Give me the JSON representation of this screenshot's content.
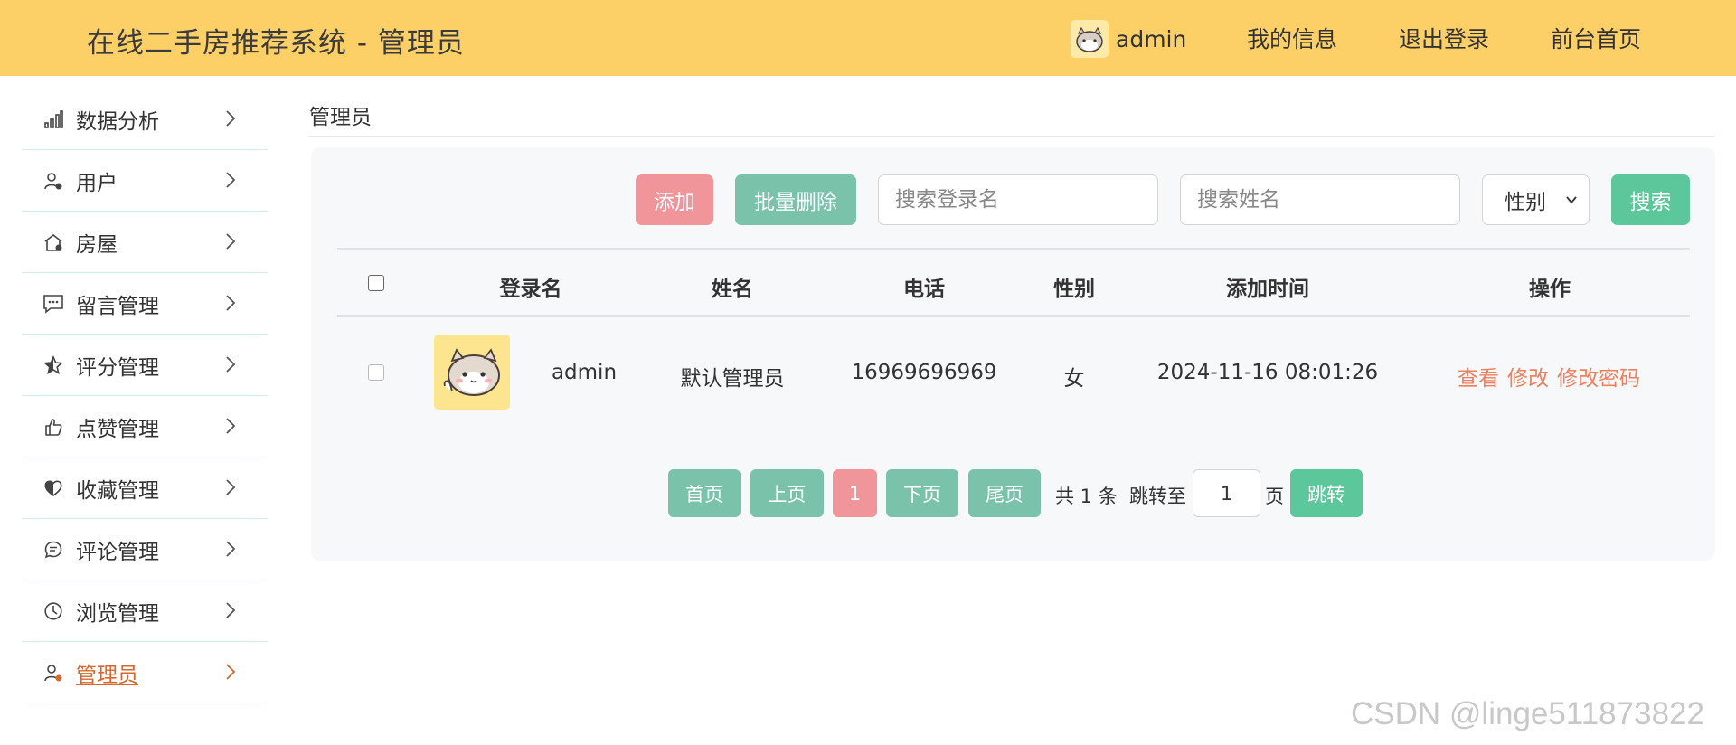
{
  "header": {
    "app_title": "在线二手房推荐系统 - 管理员",
    "username": "admin",
    "my_info": "我的信息",
    "logout": "退出登录",
    "front_home": "前台首页"
  },
  "sidebar": {
    "items": [
      {
        "label": "数据分析",
        "icon": "bar-chart-icon"
      },
      {
        "label": "用户",
        "icon": "user-icon"
      },
      {
        "label": "房屋",
        "icon": "house-icon"
      },
      {
        "label": "留言管理",
        "icon": "message-icon"
      },
      {
        "label": "评分管理",
        "icon": "star-icon"
      },
      {
        "label": "点赞管理",
        "icon": "thumbs-up-icon"
      },
      {
        "label": "收藏管理",
        "icon": "heart-icon"
      },
      {
        "label": "评论管理",
        "icon": "comment-icon"
      },
      {
        "label": "浏览管理",
        "icon": "clock-icon"
      },
      {
        "label": "管理员",
        "icon": "admin-user-icon",
        "active": true
      }
    ]
  },
  "main": {
    "page_title": "管理员",
    "toolbar": {
      "add_label": "添加",
      "batch_delete_label": "批量删除",
      "search_login_placeholder": "搜索登录名",
      "search_name_placeholder": "搜索姓名",
      "gender_select_value": "性别",
      "search_label": "搜索"
    },
    "table": {
      "columns": [
        "登录名",
        "姓名",
        "电话",
        "性别",
        "添加时间",
        "操作"
      ],
      "rows": [
        {
          "login_name": "admin",
          "name": "默认管理员",
          "phone": "16969696969",
          "gender": "女",
          "added_time": "2024-11-16 08:01:26",
          "actions": [
            "查看",
            "修改",
            "修改密码"
          ]
        }
      ]
    },
    "pagination": {
      "first": "首页",
      "prev": "上页",
      "current_page": "1",
      "next": "下页",
      "last": "尾页",
      "total_text": "共 1 条",
      "jump_to": "跳转至",
      "jump_value": "1",
      "page_unit": "页",
      "jump_button": "跳转"
    }
  },
  "colors": {
    "header_bg": "#fdcf67",
    "teal_button": "#7bc2aa",
    "pink_button": "#f0959a",
    "green_button": "#5cc79b",
    "action_link": "#ef7f5d",
    "active_nav": "#d7672b"
  },
  "watermark": "CSDN @linge511873822"
}
